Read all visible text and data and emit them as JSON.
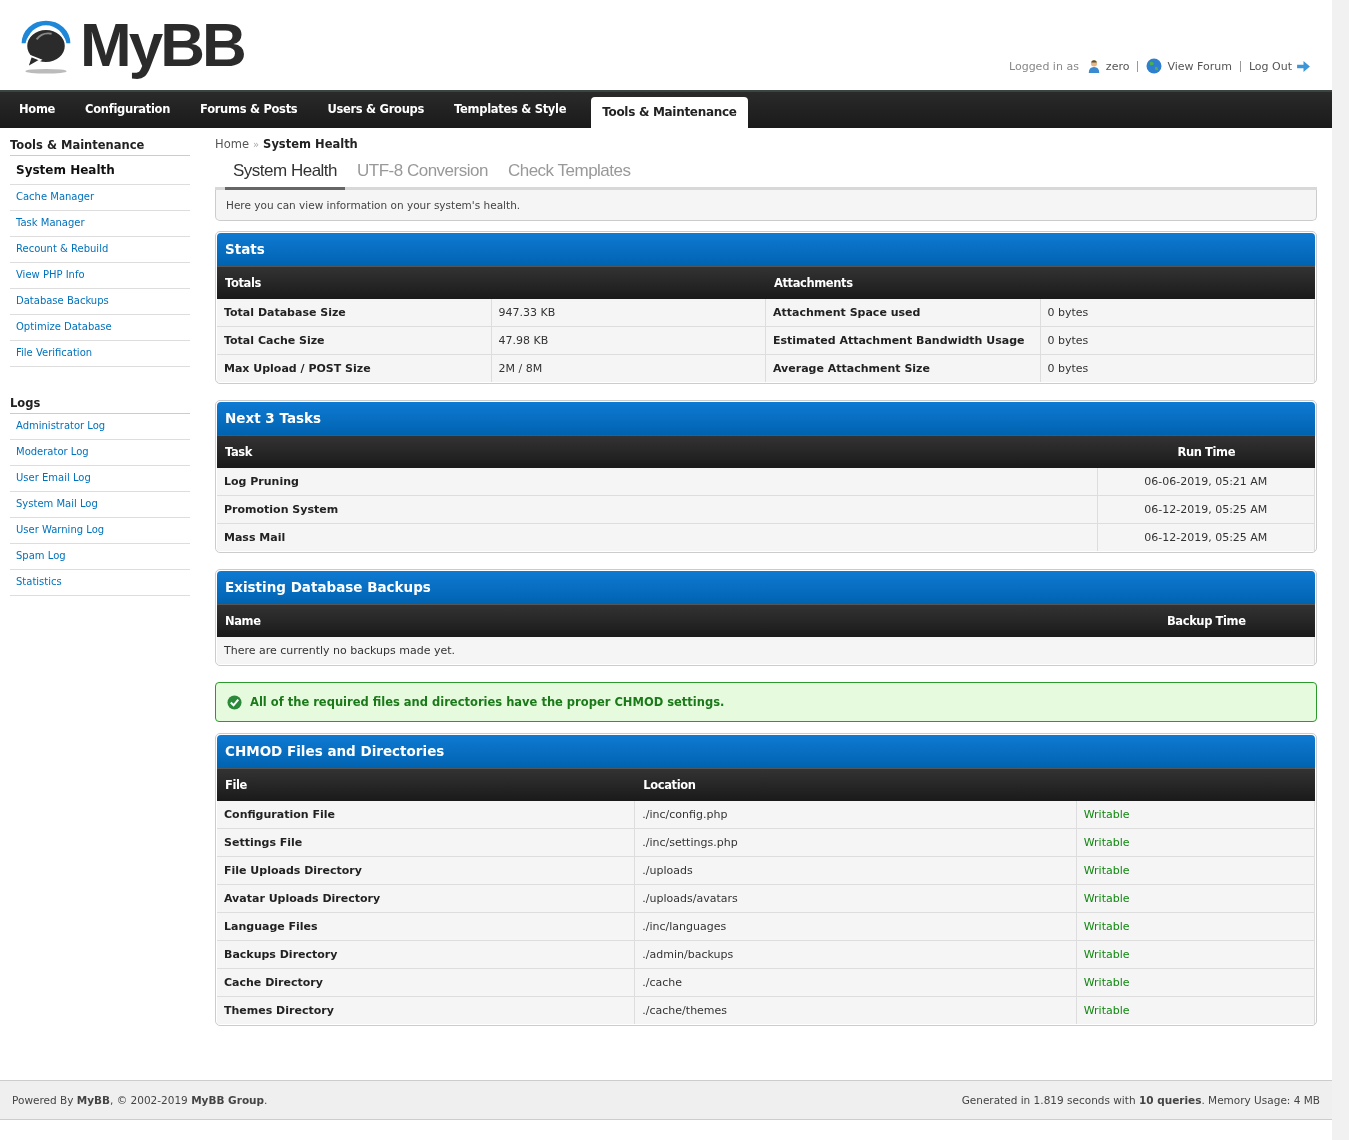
{
  "logo": {
    "text": "MyBB"
  },
  "user_bar": {
    "prefix": "Logged in as",
    "user": "zero",
    "view_forum": "View Forum",
    "log_out": "Log Out"
  },
  "nav": [
    {
      "label": "Home",
      "selected": false
    },
    {
      "label": "Configuration",
      "selected": false
    },
    {
      "label": "Forums & Posts",
      "selected": false
    },
    {
      "label": "Users & Groups",
      "selected": false
    },
    {
      "label": "Templates & Style",
      "selected": false
    },
    {
      "label": "Tools & Maintenance",
      "selected": true
    }
  ],
  "sidebar": [
    {
      "title": "Tools & Maintenance",
      "items": [
        {
          "label": "System Health",
          "selected": true
        },
        {
          "label": "Cache Manager",
          "selected": false
        },
        {
          "label": "Task Manager",
          "selected": false
        },
        {
          "label": "Recount & Rebuild",
          "selected": false
        },
        {
          "label": "View PHP Info",
          "selected": false
        },
        {
          "label": "Database Backups",
          "selected": false
        },
        {
          "label": "Optimize Database",
          "selected": false
        },
        {
          "label": "File Verification",
          "selected": false
        }
      ]
    },
    {
      "title": "Logs",
      "items": [
        {
          "label": "Administrator Log",
          "selected": false
        },
        {
          "label": "Moderator Log",
          "selected": false
        },
        {
          "label": "User Email Log",
          "selected": false
        },
        {
          "label": "System Mail Log",
          "selected": false
        },
        {
          "label": "User Warning Log",
          "selected": false
        },
        {
          "label": "Spam Log",
          "selected": false
        },
        {
          "label": "Statistics",
          "selected": false
        }
      ]
    }
  ],
  "breadcrumb": {
    "home": "Home",
    "separator": "»",
    "current": "System Health"
  },
  "subtabs": [
    {
      "label": "System Health",
      "selected": true
    },
    {
      "label": "UTF-8 Conversion",
      "selected": false
    },
    {
      "label": "Check Templates",
      "selected": false
    }
  ],
  "description": "Here you can view information on your system's health.",
  "stats": {
    "title": "Stats",
    "headers": [
      "Totals",
      "Attachments"
    ],
    "rows": [
      [
        "Total Database Size",
        "947.33 KB",
        "Attachment Space used",
        "0 bytes"
      ],
      [
        "Total Cache Size",
        "47.98 KB",
        "Estimated Attachment Bandwidth Usage",
        "0 bytes"
      ],
      [
        "Max Upload / POST Size",
        "2M / 8M",
        "Average Attachment Size",
        "0 bytes"
      ]
    ]
  },
  "tasks": {
    "title": "Next 3 Tasks",
    "columns": [
      "Task",
      "Run Time"
    ],
    "rows": [
      [
        "Log Pruning",
        "06-06-2019, 05:21 AM"
      ],
      [
        "Promotion System",
        "06-12-2019, 05:25 AM"
      ],
      [
        "Mass Mail",
        "06-12-2019, 05:25 AM"
      ]
    ]
  },
  "backups": {
    "title": "Existing Database Backups",
    "columns": [
      "Name",
      "Backup Time"
    ],
    "empty_message": "There are currently no backups made yet."
  },
  "chmod_notice": "All of the required files and directories have the proper CHMOD settings.",
  "chmod": {
    "title": "CHMOD Files and Directories",
    "columns": [
      "File",
      "Location"
    ],
    "rows": [
      [
        "Configuration File",
        "./inc/config.php",
        "Writable"
      ],
      [
        "Settings File",
        "./inc/settings.php",
        "Writable"
      ],
      [
        "File Uploads Directory",
        "./uploads",
        "Writable"
      ],
      [
        "Avatar Uploads Directory",
        "./uploads/avatars",
        "Writable"
      ],
      [
        "Language Files",
        "./inc/languages",
        "Writable"
      ],
      [
        "Backups Directory",
        "./admin/backups",
        "Writable"
      ],
      [
        "Cache Directory",
        "./cache",
        "Writable"
      ],
      [
        "Themes Directory",
        "./cache/themes",
        "Writable"
      ]
    ]
  },
  "footer": {
    "left": "Powered By **MyBB**, © 2002-2019 **MyBB Group**.",
    "right": "Generated in 1.819 seconds with **10 queries**. Memory Usage: 4 MB"
  }
}
